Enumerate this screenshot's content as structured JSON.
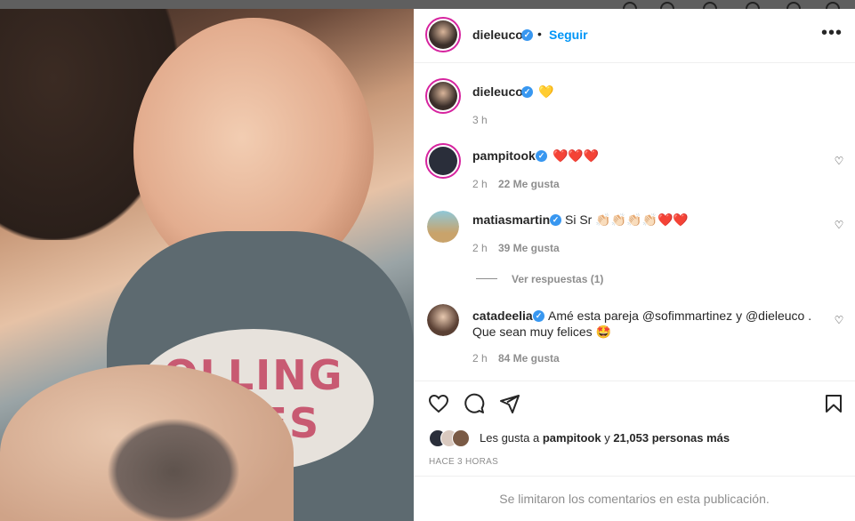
{
  "post": {
    "author": "dieleuco",
    "follow_label": "Seguir",
    "dot": "•",
    "more": "•••",
    "caption": {
      "user": "dieleuco",
      "text": "💛",
      "time": "3 h"
    },
    "photo_text": "OLLING\nONES"
  },
  "comments": [
    {
      "user": "pampitook",
      "text": "❤️❤️❤️",
      "time": "2 h",
      "likes": "22 Me gusta",
      "avatar_color": "#2a2e3a"
    },
    {
      "user": "matiasmartin",
      "text": "Si Sr 👏🏻👏🏻👏🏻👏🏻❤️❤️",
      "time": "2 h",
      "likes": "39 Me gusta",
      "avatar_color": "#c9a36b",
      "replies": "Ver respuestas (1)"
    },
    {
      "user": "catadeelia",
      "text_line1": "Amé esta pareja @sofimmartinez y @dieleuco .",
      "text_line2": "Que sean muy felices 🤩",
      "time": "2 h",
      "likes": "84 Me gusta",
      "avatar_color": "#8a6a58"
    }
  ],
  "likes_summary": {
    "prefix": "Les gusta a",
    "user": "pampitook",
    "middle": "y",
    "count": "21,053 personas más"
  },
  "timestamp": "HACE 3 HORAS",
  "comments_limited": "Se limitaron los comentarios en esta publicación.",
  "icons": {
    "like": "heart-icon",
    "comment": "comment-icon",
    "share": "share-icon",
    "save": "bookmark-icon"
  },
  "colors": {
    "follow": "#0095f6",
    "verified": "#3897f0",
    "ring": "#d6249f"
  }
}
